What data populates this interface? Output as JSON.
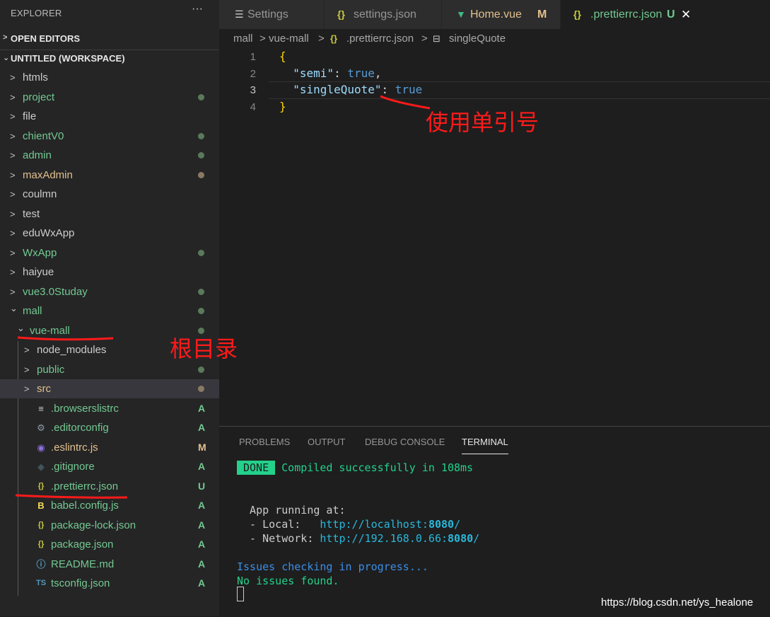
{
  "explorer": {
    "title": "EXPLORER",
    "more": "···",
    "open_editors": "OPEN EDITORS",
    "workspace": "UNTITLED (WORKSPACE)",
    "tree": [
      {
        "name": "htmls",
        "type": "folder",
        "expanded": false,
        "status": ""
      },
      {
        "name": "project",
        "type": "folder",
        "expanded": false,
        "status": "dot-green"
      },
      {
        "name": "file",
        "type": "folder",
        "expanded": false,
        "status": ""
      },
      {
        "name": "chientV0",
        "type": "folder",
        "expanded": false,
        "status": "dot-green"
      },
      {
        "name": "admin",
        "type": "folder",
        "expanded": false,
        "status": "dot-green"
      },
      {
        "name": "maxAdmin",
        "type": "folder",
        "expanded": false,
        "status": "dot-brown"
      },
      {
        "name": "coulmn",
        "type": "folder",
        "expanded": false,
        "status": ""
      },
      {
        "name": "test",
        "type": "folder",
        "expanded": false,
        "status": ""
      },
      {
        "name": "eduWxApp",
        "type": "folder",
        "expanded": false,
        "status": ""
      },
      {
        "name": "WxApp",
        "type": "folder",
        "expanded": false,
        "status": "dot-green"
      },
      {
        "name": "haiyue",
        "type": "folder",
        "expanded": false,
        "status": ""
      },
      {
        "name": "vue3.0Studay",
        "type": "folder",
        "expanded": false,
        "status": "dot-green"
      },
      {
        "name": "mall",
        "type": "folder",
        "expanded": true,
        "status": "dot-green"
      },
      {
        "name": "vue-mall",
        "type": "folder",
        "expanded": true,
        "status": "dot-green"
      },
      {
        "name": "node_modules",
        "type": "folder",
        "expanded": false,
        "status": ""
      },
      {
        "name": "public",
        "type": "folder",
        "expanded": false,
        "status": "dot-green"
      },
      {
        "name": "src",
        "type": "folder",
        "expanded": false,
        "status": "dot-brown"
      },
      {
        "name": ".browserslistrc",
        "type": "file",
        "icon": "lines-icon",
        "status": "A"
      },
      {
        "name": ".editorconfig",
        "type": "file",
        "icon": "gear-icon",
        "status": "A"
      },
      {
        "name": ".eslintrc.js",
        "type": "file",
        "icon": "eslint-icon",
        "status": "M"
      },
      {
        "name": ".gitignore",
        "type": "file",
        "icon": "git-icon",
        "status": "A"
      },
      {
        "name": ".prettierrc.json",
        "type": "file",
        "icon": "json-braces-icon",
        "status": "U"
      },
      {
        "name": "babel.config.js",
        "type": "file",
        "icon": "babel-icon",
        "status": "A"
      },
      {
        "name": "package-lock.json",
        "type": "file",
        "icon": "json-braces-icon",
        "status": "A"
      },
      {
        "name": "package.json",
        "type": "file",
        "icon": "json-braces-icon",
        "status": "A"
      },
      {
        "name": "README.md",
        "type": "file",
        "icon": "info-icon",
        "status": "A"
      },
      {
        "name": "tsconfig.json",
        "type": "file",
        "icon": "ts-icon",
        "status": "A"
      }
    ]
  },
  "tabs": [
    {
      "label": "Settings",
      "icon": "settings-lines-icon",
      "badge": ""
    },
    {
      "label": "settings.json",
      "icon": "json-braces-icon",
      "badge": ""
    },
    {
      "label": "Home.vue",
      "icon": "vue-icon",
      "badge": "M"
    },
    {
      "label": ".prettierrc.json",
      "icon": "json-braces-icon",
      "badge": "U",
      "close": "✕"
    }
  ],
  "breadcrumb": [
    "mall",
    "vue-mall",
    ".prettierrc.json",
    "singleQuote"
  ],
  "editor": {
    "line_numbers": [
      "1",
      "2",
      "3",
      "4"
    ],
    "lines": {
      "open": "{",
      "semi_key": "\"semi\"",
      "semi_val": "true",
      "sq_key": "\"singleQuote\"",
      "sq_val": "true",
      "close": "}"
    }
  },
  "annotations": {
    "single_quote_note": "使用单引号",
    "root_note": "根目录"
  },
  "panel": {
    "tabs": [
      "PROBLEMS",
      "OUTPUT",
      "DEBUG CONSOLE",
      "TERMINAL"
    ],
    "active_tab": "TERMINAL",
    "terminal": {
      "done": "DONE",
      "compiled": "Compiled successfully in 108ms",
      "app_running": "  App running at:",
      "local_label": "  - Local:   ",
      "local_url": "http://localhost:",
      "local_port": "8080",
      "local_slash": "/",
      "network_label": "  - Network: ",
      "network_url": "http://192.168.0.66:",
      "network_port": "8080",
      "network_slash": "/",
      "issues_checking": "Issues checking in progress...",
      "no_issues": "No issues found."
    }
  },
  "watermark": "https://blog.csdn.net/ys_healone",
  "colors": {
    "folder_green": "#73c991",
    "folder_brown": "#e2c08d",
    "dot_green": "#5a7a5a",
    "dot_brown": "#8a7a64",
    "badge_A": "#73c991",
    "badge_M": "#e2c08d",
    "annotation_red": "#ff1a1a"
  }
}
